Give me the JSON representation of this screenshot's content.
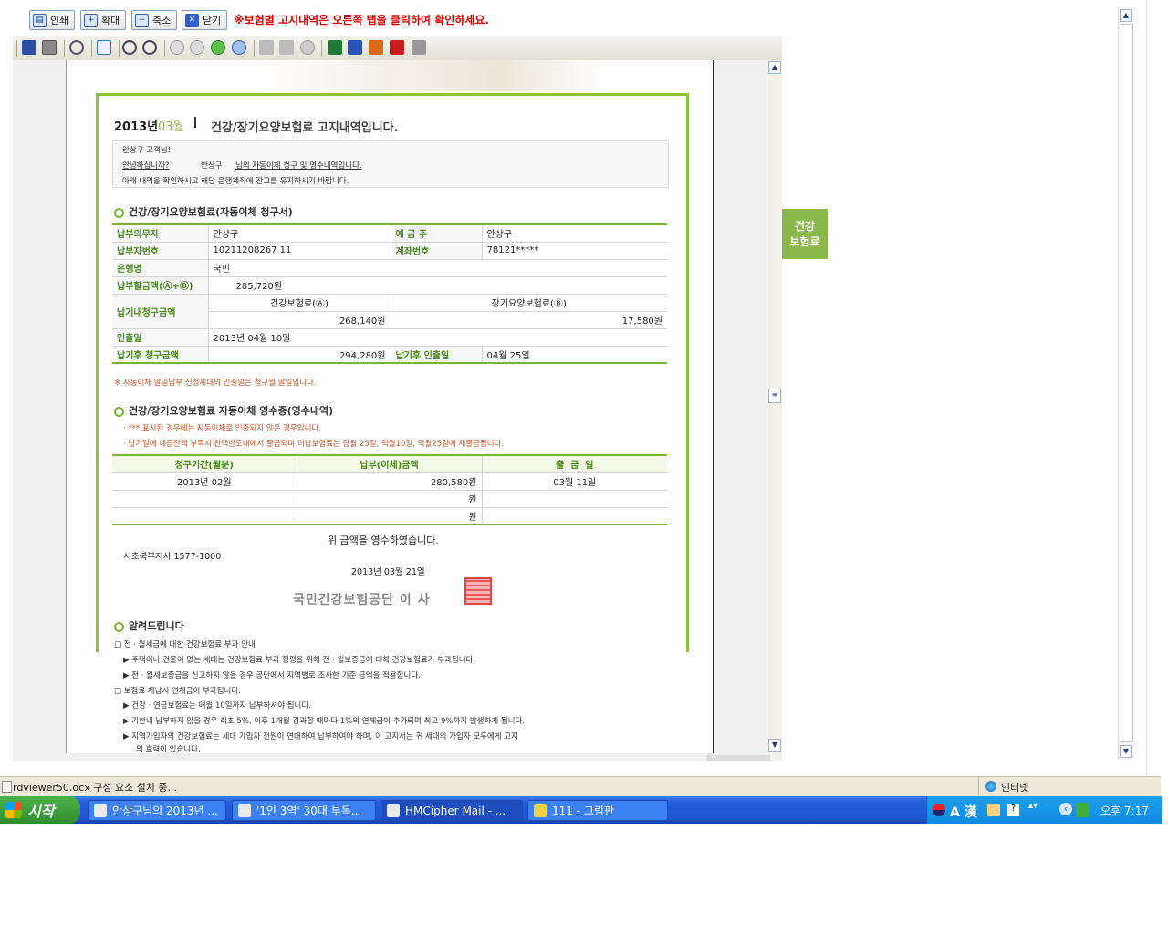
{
  "topbar": {
    "buttons": [
      {
        "label": "인쇄",
        "icon": "printer-icon"
      },
      {
        "label": "확대",
        "icon": "zoom-in-icon"
      },
      {
        "label": "축소",
        "icon": "zoom-out-icon"
      },
      {
        "label": "닫기",
        "icon": "close-icon"
      }
    ],
    "notice": "※보험별 고지내역은 오른쪽 탭을 클릭하여 확인하세요."
  },
  "document": {
    "header": {
      "year": "2013년",
      "month": "03월",
      "title": "건강/장기요양보험료 고지내역입니다."
    },
    "greeting": {
      "line1": "안상구 고객님!",
      "line2_prefix": "안녕하십니까?",
      "line2_name": "안상구",
      "line2_link": "님의 자동이체 청구 및 영수내역입니다.",
      "line3": "아래 내역을 확인하시고 해당 은행계좌에 잔고를 유지하시기 바랍니다."
    },
    "section1": {
      "title": "건강/장기요양보험료(자동이체 청구서)",
      "payer_label": "납부의무자",
      "payer_value": "안상구",
      "depositor_label": "예 금 주",
      "depositor_value": "안상구",
      "payer_no_label": "납부자번호",
      "payer_no_value": "10211208267 11",
      "account_label": "계좌번호",
      "account_value": "78121*****",
      "bank_label": "은행명",
      "bank_value": "국민",
      "amount_label": "납부할금액(Ⓐ+Ⓑ)",
      "amount_value": "285,720원",
      "due_label": "납기내청구금액",
      "health_label": "건강보험료(Ⓐ)",
      "ltc_label": "장기요양보험료(Ⓑ)",
      "health_value": "268,140원",
      "ltc_value": "17,580원",
      "withdraw_label": "인출일",
      "withdraw_value": "2013년 04월 10일",
      "late_amount_label": "납기후 청구금액",
      "late_amount_value": "294,280원",
      "late_withdraw_label": "납기후 인출일",
      "late_withdraw_value": "04월 25일",
      "footnote": "※ 자동이체 말일납부 신청세대의 인출일은 청구월 말일입니다."
    },
    "section2": {
      "title": "건강/장기요양보험료 자동이체 영수증(영수내역)",
      "note1": "· *** 표시된 경우에는 자동이체로 인출되지 않은 경우입니다.",
      "note2": "· 납기일에 예금잔액 부족시 잔액한도내에서 출금되며 미납보험료는 당월 25일, 익월10일, 익월25일에 재출금됩니다.",
      "headers": [
        "청구기간(월분)",
        "납부(이체)금액",
        "출  금  일"
      ],
      "rows": [
        {
          "period": "2013년 02월",
          "amount": "280,580원",
          "date": "03월 11일"
        },
        {
          "period": "",
          "amount": "원",
          "date": ""
        },
        {
          "period": "",
          "amount": "원",
          "date": ""
        }
      ],
      "receipt_text": "위 금액을 영수하였습니다.",
      "branch": "서초북부지사 1577-1000",
      "date": "2013년 03월 21일",
      "issuer": "국민건강보험공단 이 사"
    },
    "section3": {
      "title": "알려드립니다",
      "items": [
        "□ 전 · 월세금에 대한 건강보험료 부과 안내",
        "▶ 주택이나 건물이 없는 세대는 건강보험료 부과 형평을 위해 전 · 월보증금에 대해 건강보험료가 부과됩니다.",
        "▶ 전 · 월세보증금을 신고하지 않을 경우 공단에서 지역별로 조사한 기준 금액을 적용합니다.",
        "□ 보험료 체납시 연체금이 부과됩니다.",
        "▶ 건강 · 연금보험료는 매월 10일까지 납부하셔야 됩니다.",
        "▶ 기한내 납부하지 않을 경우 최초 5%, 이후 1개월 경과할 때마다 1%의 연체금이 추가되며 최고 9%까지 발생하게 됩니다.",
        "▶ 지역가입자의 건강보험료는 세대 가입자 전원이 연대하여 납부하여야 하며, 이 고지서는 귀 세대의 가입자 모두에게 고지",
        "의 효력이 있습니다."
      ]
    }
  },
  "side_tab": {
    "line1": "건강",
    "line2": "보험료"
  },
  "statusbar": {
    "text": "rdviewer50.ocx 구성 요소 설치 중...",
    "zone": "인터넷"
  },
  "taskbar": {
    "start": "시작",
    "tasks": [
      "안상구님의 2013년 ...",
      "'1인 3역' 30대 부목...",
      "HMCipher Mail - ...",
      "111 - 그림판"
    ],
    "tray_lang": "A 漢",
    "time": "오후 7:17"
  }
}
